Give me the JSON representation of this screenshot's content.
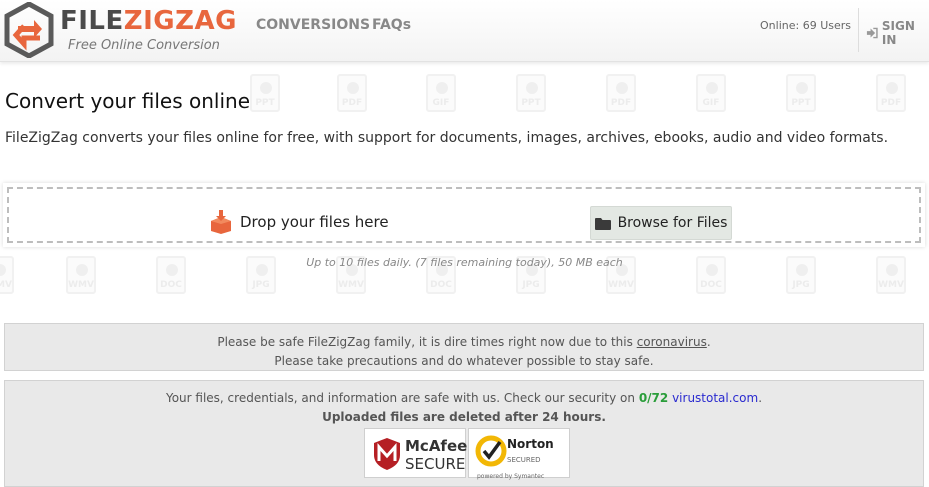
{
  "header": {
    "logo_main": "FILE",
    "logo_accent": "ZIGZAG",
    "tagline": "Free Online Conversion",
    "nav": [
      "CONVERSIONS",
      "FAQs"
    ],
    "online": "Online: 69 Users",
    "signin": "SIGN IN"
  },
  "watermark_row1": [
    "PPT",
    "PDF",
    "GIF",
    "PPT",
    "PDF",
    "GIF",
    "PPT",
    "PDF"
  ],
  "watermark_row2": [
    "WMV",
    "DOC",
    "JPG",
    "WMV",
    "DOC",
    "JPG",
    "WMV",
    "DOC",
    "JPG",
    "WMV"
  ],
  "main": {
    "title": "Convert your files online",
    "description": "FileZigZag converts your files online for free, with support for documents, images, archives, ebooks, audio and video formats.",
    "drop_label": "Drop your files here",
    "browse_label": "Browse for Files",
    "limit_text": "Up to 10 files daily. (7 files remaining today), 50 MB each"
  },
  "notice": {
    "line1_pre": "Please be safe FileZigZag family, it is dire times right now due to this ",
    "line1_link": "coronavirus",
    "line1_post": ".",
    "line2": "Please take precautions and do whatever possible to stay safe."
  },
  "security": {
    "line1_pre": "Your files, credentials, and information are safe with us. Check our security on ",
    "score": "0/72",
    "site": "virustotal.com",
    "line1_post": ".",
    "line2": "Uploaded files are deleted after 24 hours.",
    "mcafee_top": "McAfee",
    "mcafee_bottom": "SECURE",
    "norton_top": "Norton",
    "norton_mid": "SECURED",
    "norton_bottom": "powered by Symantec"
  },
  "colors": {
    "brand_orange": "#e8663d",
    "logo_gray": "#4a4a4a",
    "score_green": "#2a9d3a",
    "link_blue": "#2a2acf"
  }
}
